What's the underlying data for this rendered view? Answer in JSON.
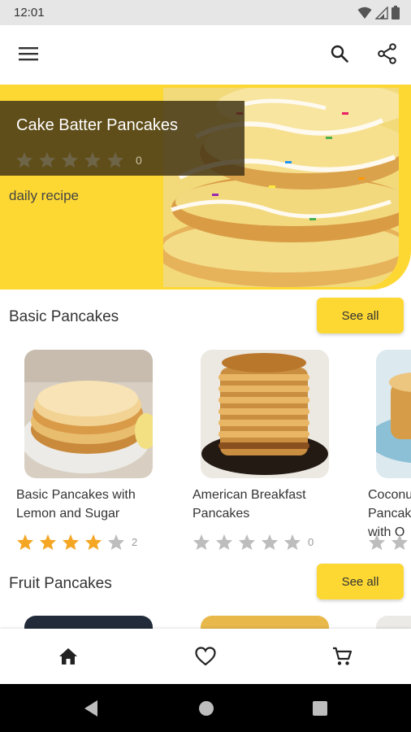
{
  "status": {
    "time": "12:01"
  },
  "colors": {
    "accent": "#fdd833",
    "star_filled": "#f5a623",
    "star_empty": "#bdbdbd"
  },
  "icons": {
    "menu": "hamburger-menu-icon",
    "search": "search-icon",
    "share": "share-icon",
    "home": "home-icon",
    "favorites": "heart-icon",
    "cart": "cart-icon",
    "back": "back-triangle-icon",
    "home_sys": "home-circle-icon",
    "recents": "recents-square-icon"
  },
  "hero": {
    "title": "Cake Batter Pancakes",
    "rating": 0,
    "rating_count": "0",
    "subtitle": "daily recipe"
  },
  "sections": [
    {
      "title": "Basic Pancakes",
      "see_all_label": "See all",
      "items": [
        {
          "title": "Basic Pancakes with Lemon and Sugar",
          "rating": 4,
          "rating_count": "2"
        },
        {
          "title": "American Breakfast Pancakes",
          "rating": 0,
          "rating_count": "0"
        },
        {
          "title": "Coconut Pancakes with O",
          "rating": 0,
          "rating_count": ""
        }
      ]
    },
    {
      "title": "Fruit Pancakes",
      "see_all_label": "See all"
    }
  ]
}
